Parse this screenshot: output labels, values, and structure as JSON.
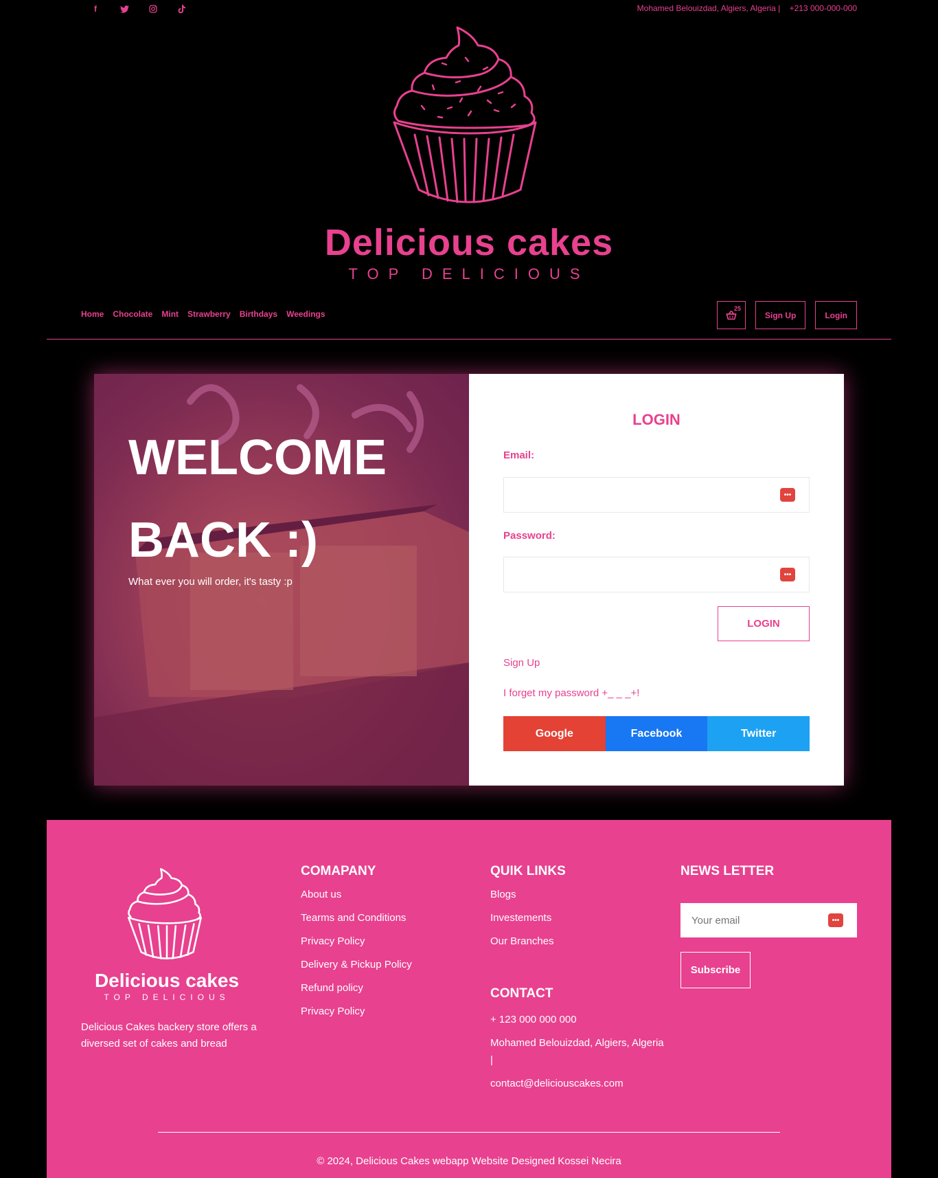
{
  "topbar": {
    "social": [
      "facebook-icon",
      "twitter-icon",
      "instagram-icon",
      "tiktok-icon"
    ],
    "address": "Mohamed Belouizdad, Algiers, Algeria |",
    "phone": "+213 000-000-000"
  },
  "brand": {
    "title": "Delicious cakes",
    "subtitle": "TOP DELICIOUS"
  },
  "nav": {
    "items": [
      "Home",
      "Chocolate",
      "Mint",
      "Strawberry",
      "Birthdays",
      "Weedings"
    ],
    "cart_count": "25",
    "signup_label": "Sign Up",
    "login_label": "Login"
  },
  "hero": {
    "welcome_line1": "WELCOME",
    "welcome_line2": "BACK :)",
    "tagline": "What ever you will order, it's tasty :p"
  },
  "login_form": {
    "title": "LOGIN",
    "email_label": "Email:",
    "email_value": "",
    "password_label": "Password:",
    "password_value": "",
    "submit_label": "LOGIN",
    "signup_link": "Sign Up",
    "forgot_link": "I forget my password +_ _ _+!",
    "oauth": {
      "google": "Google",
      "facebook": "Facebook",
      "twitter": "Twitter"
    }
  },
  "footer": {
    "brand_title": "Delicious cakes",
    "brand_subtitle": "TOP DELICIOUS",
    "about": "Delicious Cakes backery store offers a diversed set of cakes and bread",
    "company": {
      "title": "COMAPANY",
      "items": [
        "About us",
        "Tearms and Conditions",
        "Privacy Policy",
        "Delivery & Pickup Policy",
        "Refund policy",
        "Privacy Policy"
      ]
    },
    "quick_links": {
      "title": "QUIK LINKS",
      "items": [
        "Blogs",
        "Investements",
        "Our Branches"
      ]
    },
    "contact": {
      "title": "CONTACT",
      "phone": "+ 123 000 000 000",
      "address": "Mohamed Belouizdad, Algiers, Algeria |",
      "email": "contact@deliciouscakes.com"
    },
    "newsletter": {
      "title": "NEWS LETTER",
      "placeholder": "Your email",
      "subscribe_label": "Subscribe"
    },
    "copyright": "© 2024, Delicious Cakes webapp Website Designed Kossei Necira"
  },
  "colors": {
    "accent": "#e8418f",
    "background": "#000000",
    "google": "#e34234",
    "facebook": "#1877f2",
    "twitter": "#1da1f2"
  }
}
